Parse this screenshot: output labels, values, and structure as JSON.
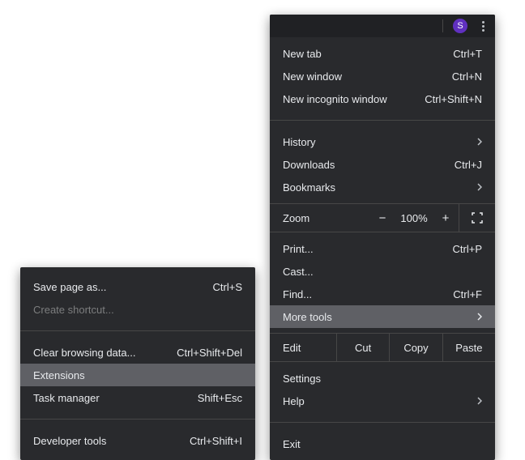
{
  "titlebar": {
    "avatar_letter": "S"
  },
  "main": {
    "new_tab": {
      "label": "New tab",
      "shortcut": "Ctrl+T"
    },
    "new_window": {
      "label": "New window",
      "shortcut": "Ctrl+N"
    },
    "new_incognito": {
      "label": "New incognito window",
      "shortcut": "Ctrl+Shift+N"
    },
    "history": {
      "label": "History"
    },
    "downloads": {
      "label": "Downloads",
      "shortcut": "Ctrl+J"
    },
    "bookmarks": {
      "label": "Bookmarks"
    },
    "zoom": {
      "label": "Zoom",
      "minus": "−",
      "value": "100%",
      "plus": "+"
    },
    "print": {
      "label": "Print...",
      "shortcut": "Ctrl+P"
    },
    "cast": {
      "label": "Cast..."
    },
    "find": {
      "label": "Find...",
      "shortcut": "Ctrl+F"
    },
    "more_tools": {
      "label": "More tools"
    },
    "edit": {
      "label": "Edit",
      "cut": "Cut",
      "copy": "Copy",
      "paste": "Paste"
    },
    "settings": {
      "label": "Settings"
    },
    "help": {
      "label": "Help"
    },
    "exit": {
      "label": "Exit"
    }
  },
  "sub": {
    "save_page": {
      "label": "Save page as...",
      "shortcut": "Ctrl+S"
    },
    "create_shortcut": {
      "label": "Create shortcut..."
    },
    "clear_browsing": {
      "label": "Clear browsing data...",
      "shortcut": "Ctrl+Shift+Del"
    },
    "extensions": {
      "label": "Extensions"
    },
    "task_manager": {
      "label": "Task manager",
      "shortcut": "Shift+Esc"
    },
    "dev_tools": {
      "label": "Developer tools",
      "shortcut": "Ctrl+Shift+I"
    }
  }
}
